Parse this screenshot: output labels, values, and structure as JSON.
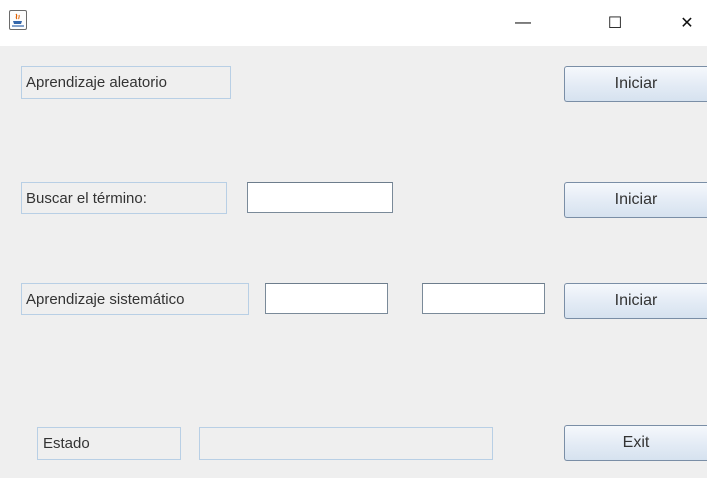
{
  "window": {
    "icon": "java-cup-icon",
    "controls": {
      "minimize": "—",
      "maximize": "☐",
      "close": "✕"
    }
  },
  "rows": {
    "random": {
      "label": "Aprendizaje aleatorio",
      "button": "Iniciar"
    },
    "search": {
      "label": "Buscar el término:",
      "field_value": "",
      "button": "Iniciar"
    },
    "systematic": {
      "label": "Aprendizaje sistemático",
      "field1_value": "",
      "field2_value": "",
      "button": "Iniciar"
    },
    "status": {
      "label": "Estado",
      "value": "",
      "button": "Exit"
    }
  }
}
